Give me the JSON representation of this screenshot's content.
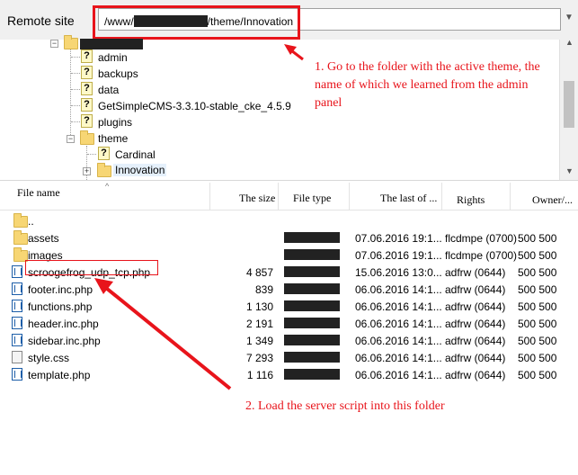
{
  "remote": {
    "label": "Remote site",
    "path_prefix": "/www/",
    "path_suffix": "/theme/Innovation"
  },
  "tree": {
    "items": [
      {
        "label": "admin"
      },
      {
        "label": "backups"
      },
      {
        "label": "data"
      },
      {
        "label": "GetSimpleCMS-3.3.10-stable_cke_4.5.9"
      },
      {
        "label": "plugins"
      },
      {
        "label": "theme"
      },
      {
        "label": "Cardinal"
      },
      {
        "label": "Innovation"
      }
    ]
  },
  "columns": {
    "name": "File name",
    "size": "The size",
    "type": "File type",
    "modified": "The last of ...",
    "rights": "Rights",
    "owner": "Owner/..."
  },
  "files": [
    {
      "name": "..",
      "size": "",
      "date": "",
      "rights": "",
      "owner": "",
      "icon": "folder"
    },
    {
      "name": "assets",
      "size": "",
      "date": "07.06.2016 19:1...",
      "rights": "flcdmpe (0700)",
      "owner": "500 500",
      "icon": "folder"
    },
    {
      "name": "images",
      "size": "",
      "date": "07.06.2016 19:1...",
      "rights": "flcdmpe (0700)",
      "owner": "500 500",
      "icon": "folder"
    },
    {
      "name": "scroogefrog_udp_tcp.php",
      "size": "4 857",
      "date": "15.06.2016 13:0...",
      "rights": "adfrw (0644)",
      "owner": "500 500",
      "icon": "php"
    },
    {
      "name": "footer.inc.php",
      "size": "839",
      "date": "06.06.2016 14:1...",
      "rights": "adfrw (0644)",
      "owner": "500 500",
      "icon": "php"
    },
    {
      "name": "functions.php",
      "size": "1 130",
      "date": "06.06.2016 14:1...",
      "rights": "adfrw (0644)",
      "owner": "500 500",
      "icon": "php"
    },
    {
      "name": "header.inc.php",
      "size": "2 191",
      "date": "06.06.2016 14:1...",
      "rights": "adfrw (0644)",
      "owner": "500 500",
      "icon": "php"
    },
    {
      "name": "sidebar.inc.php",
      "size": "1 349",
      "date": "06.06.2016 14:1...",
      "rights": "adfrw (0644)",
      "owner": "500 500",
      "icon": "php"
    },
    {
      "name": "style.css",
      "size": "7 293",
      "date": "06.06.2016 14:1...",
      "rights": "adfrw (0644)",
      "owner": "500 500",
      "icon": "css"
    },
    {
      "name": "template.php",
      "size": "1 116",
      "date": "06.06.2016 14:1...",
      "rights": "adfrw (0644)",
      "owner": "500 500",
      "icon": "php"
    }
  ],
  "annotations": {
    "note1": "1. Go to the folder with the active theme, the name of which we learned from the admin panel",
    "note2": "2. Load the server script into this folder"
  },
  "colors": {
    "annotation": "#e8141b",
    "folder": "#f7d674",
    "php_icon": "#1d5ea8"
  }
}
